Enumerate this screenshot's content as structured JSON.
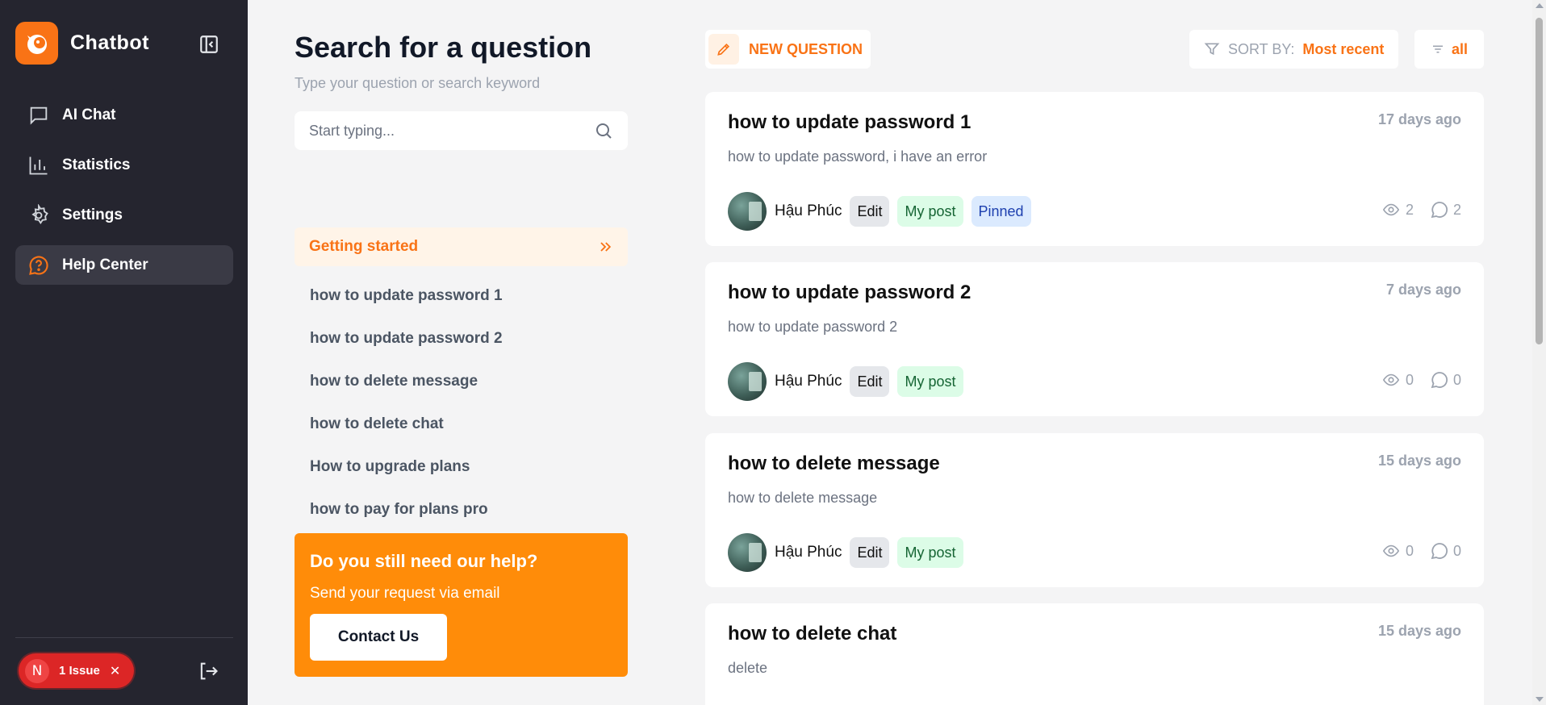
{
  "sidebar": {
    "brand": "Chatbot",
    "items": [
      {
        "label": "AI Chat",
        "icon": "chat-icon"
      },
      {
        "label": "Statistics",
        "icon": "bar-chart-icon"
      },
      {
        "label": "Settings",
        "icon": "gear-icon"
      },
      {
        "label": "Help Center",
        "icon": "help-circle-icon",
        "active": true
      }
    ],
    "issue": {
      "avatar": "N",
      "label": "1 Issue"
    }
  },
  "search_panel": {
    "title": "Search for a question",
    "subtitle": "Type your question or search keyword",
    "search_placeholder": "Start typing...",
    "category": "Getting started",
    "topics": [
      "how to update password 1",
      "how to update password 2",
      "how to delete message",
      "how to delete chat",
      "How to upgrade plans",
      "how to pay for plans pro"
    ],
    "help": {
      "title": "Do you still need our help?",
      "text": "Send your request via email",
      "button": "Contact Us"
    }
  },
  "toolbar": {
    "new_question": "NEW QUESTION",
    "sort_label": "SORT BY:",
    "sort_value": "Most recent",
    "filter_label": "all"
  },
  "posts": [
    {
      "title": "how to update password 1",
      "time": "17 days ago",
      "desc": "how to update password, i have an error",
      "author": "Hậu Phúc",
      "edit": "Edit",
      "mine": "My post",
      "pinned": "Pinned",
      "views": "2",
      "comments": "2"
    },
    {
      "title": "how to update password 2",
      "time": "7 days ago",
      "desc": "how to update password 2",
      "author": "Hậu Phúc",
      "edit": "Edit",
      "mine": "My post",
      "views": "0",
      "comments": "0"
    },
    {
      "title": "how to delete message",
      "time": "15 days ago",
      "desc": "how to delete message",
      "author": "Hậu Phúc",
      "edit": "Edit",
      "mine": "My post",
      "views": "0",
      "comments": "0"
    },
    {
      "title": "how to delete chat",
      "time": "15 days ago",
      "desc": "delete"
    }
  ],
  "colors": {
    "accent": "#f97316",
    "sidebar_bg": "#25252f",
    "help_card": "#ff8c09"
  }
}
